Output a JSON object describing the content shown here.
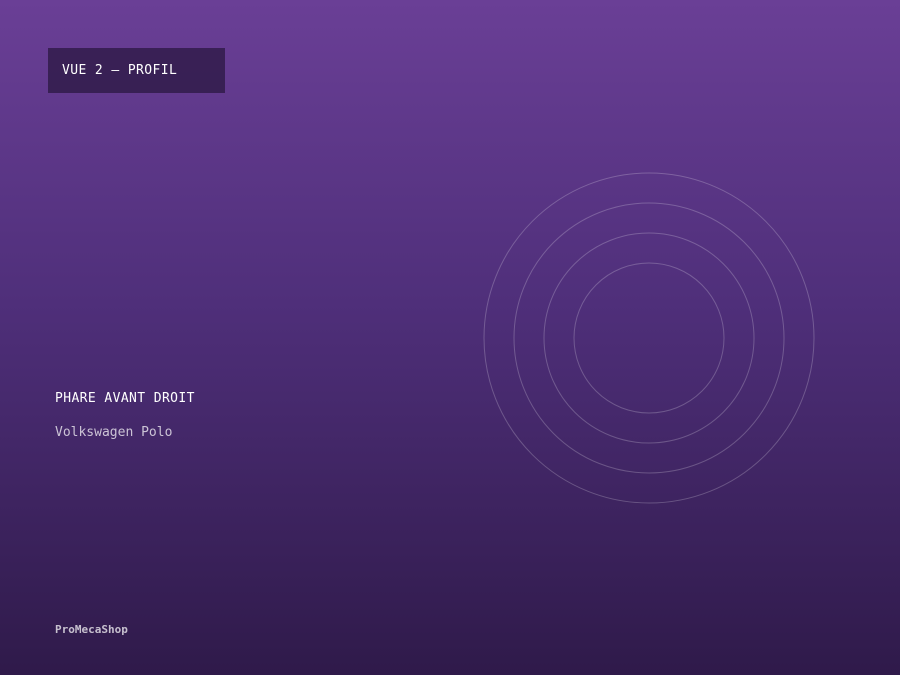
{
  "badge": {
    "label": "VUE 2 — PROFIL"
  },
  "part": {
    "name": "PHARE AVANT DROIT",
    "vehicle": "Volkswagen Polo"
  },
  "footer": {
    "brand": "ProMecaShop"
  },
  "colors": {
    "background_top": "#6a3f96",
    "background_bottom": "#2f1a4a",
    "badge_background": "#2e1a48"
  }
}
